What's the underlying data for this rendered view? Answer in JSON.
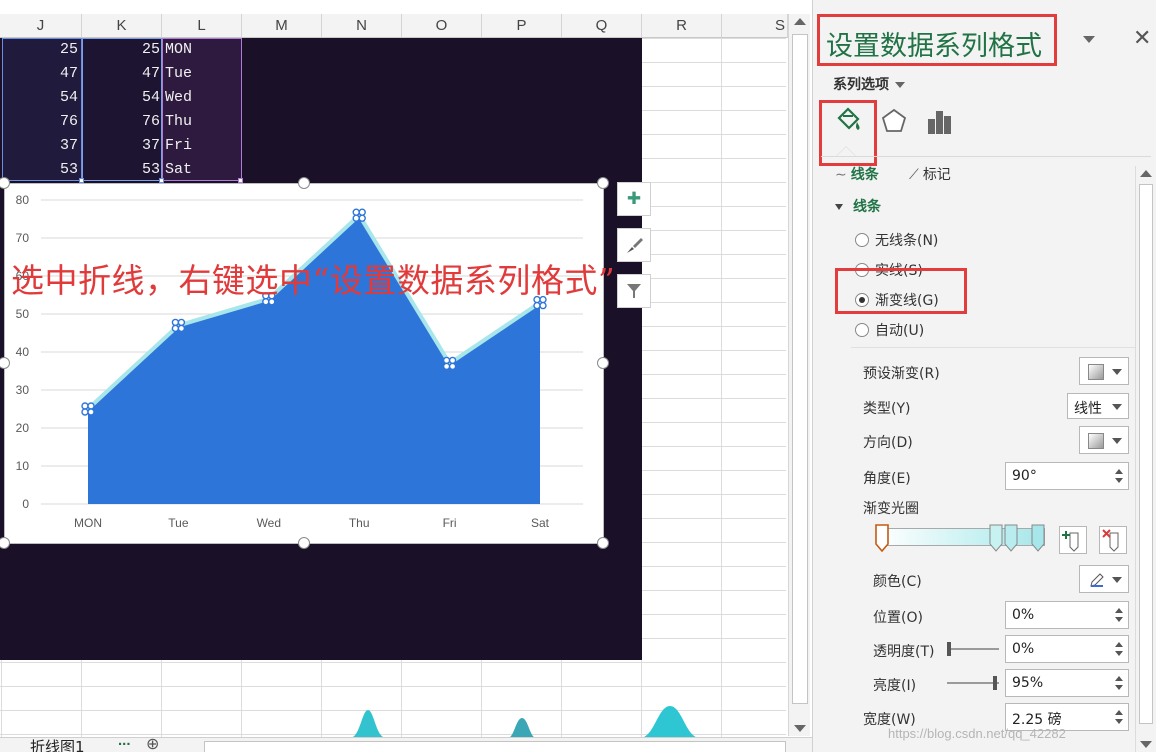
{
  "sheet": {
    "columns": [
      "J",
      "K",
      "L",
      "M",
      "N",
      "O",
      "P",
      "Q",
      "R",
      "S"
    ],
    "rows": [
      {
        "j": "25",
        "k": "25",
        "l": "MON"
      },
      {
        "j": "47",
        "k": "47",
        "l": "Tue"
      },
      {
        "j": "54",
        "k": "54",
        "l": "Wed"
      },
      {
        "j": "76",
        "k": "76",
        "l": "Thu"
      },
      {
        "j": "37",
        "k": "37",
        "l": "Fri"
      },
      {
        "j": "53",
        "k": "53",
        "l": "Sat"
      }
    ],
    "tab_label": "折线图1",
    "tab_more": "...",
    "add_sheet": "⊕",
    "colors": {
      "dark_background": "#1a1027",
      "grid": "#dcdcdc"
    }
  },
  "annotation": "选中折线，右键选中“设置数据系列格式”",
  "chart_buttons": [
    {
      "icon": "plus-icon",
      "glyph": "✚"
    },
    {
      "icon": "brush-icon",
      "glyph": "🖌"
    },
    {
      "icon": "filter-icon",
      "glyph": "⛛"
    }
  ],
  "chart_data": {
    "type": "area",
    "categories": [
      "MON",
      "Tue",
      "Wed",
      "Thu",
      "Fri",
      "Sat"
    ],
    "series": [
      {
        "values": [
          25,
          47,
          54,
          76,
          37,
          53
        ],
        "kind": "area",
        "color": "#2e75d9"
      },
      {
        "values": [
          25,
          47,
          54,
          76,
          37,
          53
        ],
        "kind": "line",
        "color": "#a7e6ea",
        "selected": true
      }
    ],
    "yticks": [
      0,
      10,
      20,
      30,
      40,
      50,
      60,
      70,
      80
    ],
    "ylim": [
      0,
      80
    ],
    "grid": true,
    "title": "",
    "xlabel": "",
    "ylabel": ""
  },
  "pane": {
    "title": "设置数据系列格式",
    "close": "✕",
    "series_options": "系列选项",
    "tab_icons": [
      "fill-line-icon",
      "effects-icon",
      "series-options-icon"
    ],
    "subtabs": [
      "线条",
      "标记"
    ],
    "section": "线条",
    "radios": [
      {
        "label": "无线条(N)",
        "checked": false
      },
      {
        "label": "实线(S)",
        "checked": false
      },
      {
        "label": "渐变线(G)",
        "checked": true
      },
      {
        "label": "自动(U)",
        "checked": false
      }
    ],
    "props": {
      "preset_gradient": "预设渐变(R)",
      "type": "类型(Y)",
      "type_value": "线性",
      "direction": "方向(D)",
      "angle": "角度(E)",
      "angle_value": "90°",
      "gradient_stops": "渐变光圈",
      "color": "颜色(C)",
      "position": "位置(O)",
      "position_value": "0%",
      "transparency": "透明度(T)",
      "transparency_value": "0%",
      "transparency_level": 0,
      "brightness": "亮度(I)",
      "brightness_value": "95%",
      "brightness_level": 0.95,
      "width": "宽度(W)",
      "width_value": "2.25 磅"
    },
    "colors": {
      "accent": "#217346",
      "highlight_box": "#e33c3c",
      "gradient_end": "#a7e6ea"
    }
  },
  "watermark": "https://blog.csdn.net/qq_42282"
}
